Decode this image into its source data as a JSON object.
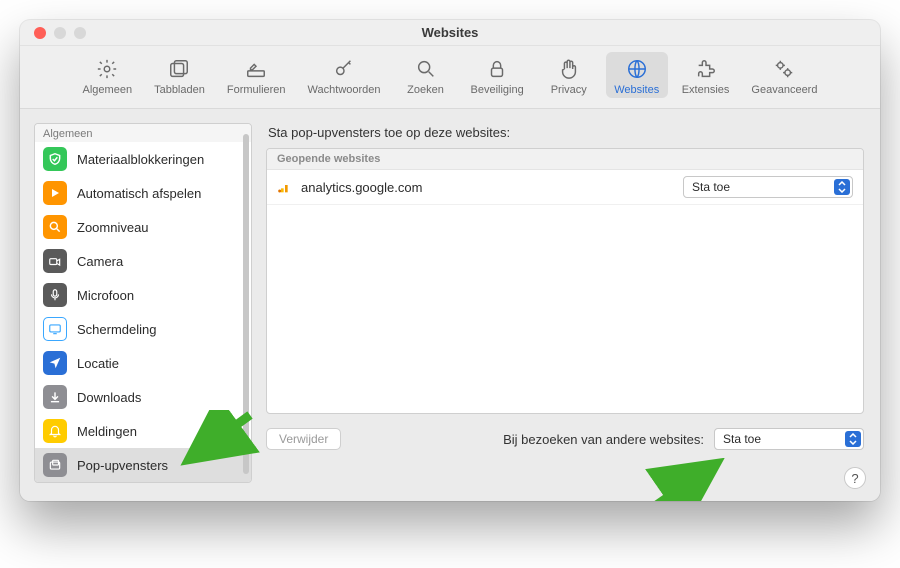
{
  "window": {
    "title": "Websites"
  },
  "toolbar": {
    "tabs": [
      {
        "label": "Algemeen"
      },
      {
        "label": "Tabbladen"
      },
      {
        "label": "Formulieren"
      },
      {
        "label": "Wachtwoorden"
      },
      {
        "label": "Zoeken"
      },
      {
        "label": "Beveiliging"
      },
      {
        "label": "Privacy"
      },
      {
        "label": "Websites"
      },
      {
        "label": "Extensies"
      },
      {
        "label": "Geavanceerd"
      }
    ],
    "active_index": 7
  },
  "sidebar": {
    "header": "Algemeen",
    "items": [
      {
        "label": "Materiaalblokkeringen",
        "icon": "shield",
        "color": "#34c759"
      },
      {
        "label": "Automatisch afspelen",
        "icon": "play",
        "color": "#ff9500"
      },
      {
        "label": "Zoomniveau",
        "icon": "zoom",
        "color": "#ff9500"
      },
      {
        "label": "Camera",
        "icon": "camera",
        "color": "#5a5a5a"
      },
      {
        "label": "Microfoon",
        "icon": "mic",
        "color": "#5a5a5a"
      },
      {
        "label": "Schermdeling",
        "icon": "screen",
        "color": "#3aa7ff"
      },
      {
        "label": "Locatie",
        "icon": "location",
        "color": "#2a6fd6"
      },
      {
        "label": "Downloads",
        "icon": "download",
        "color": "#8e8e93"
      },
      {
        "label": "Meldingen",
        "icon": "bell",
        "color": "#ffcc00"
      },
      {
        "label": "Pop-upvensters",
        "icon": "popup",
        "color": "#8e8e93"
      }
    ],
    "selected_index": 9
  },
  "main": {
    "title": "Sta pop-upvensters toe op deze websites:",
    "list_header": "Geopende websites",
    "sites": [
      {
        "domain": "analytics.google.com",
        "permission": "Sta toe"
      }
    ],
    "remove_button": "Verwijder",
    "default_label": "Bij bezoeken van andere websites:",
    "default_value": "Sta toe"
  },
  "help": "?",
  "colors": {
    "accent": "#2a6fd6",
    "annotation": "#3fae2a"
  }
}
